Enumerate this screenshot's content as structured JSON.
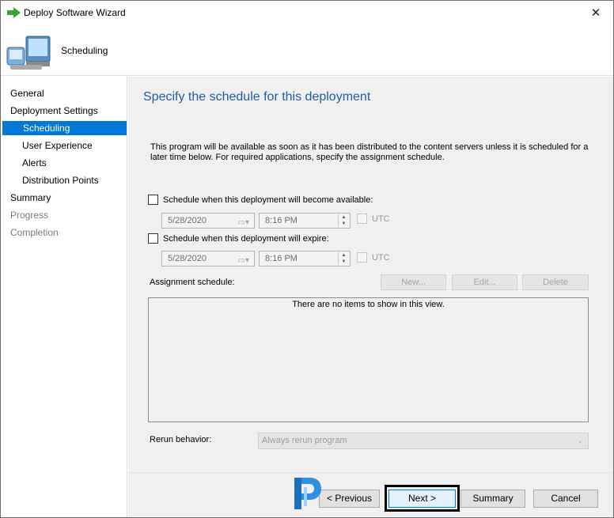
{
  "window": {
    "title": "Deploy Software Wizard",
    "close_glyph": "✕"
  },
  "banner": {
    "title": "Scheduling",
    "icon": "computer-icon"
  },
  "nav": {
    "items": [
      {
        "label": "General",
        "state": "normal"
      },
      {
        "label": "Deployment Settings",
        "state": "normal"
      },
      {
        "label": "Scheduling",
        "state": "active"
      },
      {
        "label": "User Experience",
        "state": "normal"
      },
      {
        "label": "Alerts",
        "state": "normal"
      },
      {
        "label": "Distribution Points",
        "state": "normal"
      },
      {
        "label": "Summary",
        "state": "normal"
      },
      {
        "label": "Progress",
        "state": "disabled"
      },
      {
        "label": "Completion",
        "state": "disabled"
      }
    ]
  },
  "content": {
    "heading": "Specify the schedule for this deployment",
    "description": "This program will be available as soon as it has been distributed to the content servers unless it is scheduled for a later time below. For required applications, specify the assignment schedule.",
    "available": {
      "label": "Schedule when this deployment will become available:",
      "checked": false,
      "date": "5/28/2020",
      "time": "8:16 PM",
      "utc_label": "UTC"
    },
    "expire": {
      "label": "Schedule when this deployment will expire:",
      "checked": false,
      "date": "5/28/2020",
      "time": "8:16 PM",
      "utc_label": "UTC"
    },
    "assignment": {
      "label": "Assignment schedule:",
      "new_label": "New...",
      "edit_label": "Edit...",
      "delete_label": "Delete",
      "empty_text": "There are no items to show in this view."
    },
    "rerun": {
      "label": "Rerun behavior:",
      "value": "Always rerun program"
    }
  },
  "footer": {
    "previous_label": "< Previous",
    "next_label": "Next >",
    "summary_label": "Summary",
    "cancel_label": "Cancel"
  },
  "colors": {
    "accent": "#0078d7",
    "heading": "#1e5ca8",
    "panel": "#f0f0f0"
  }
}
